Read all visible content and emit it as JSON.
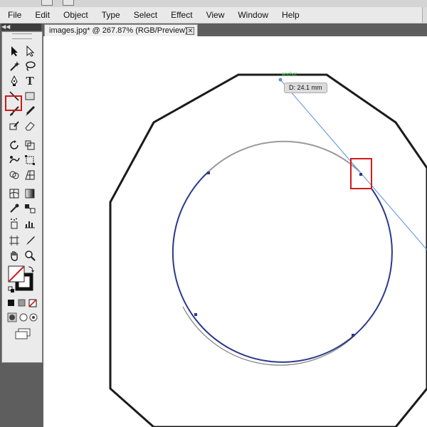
{
  "menu": {
    "items": [
      "File",
      "Edit",
      "Object",
      "Type",
      "Select",
      "Effect",
      "View",
      "Window",
      "Help"
    ]
  },
  "document": {
    "tab_title": "images.jpg* @ 267.87% (RGB/Preview)",
    "close_glyph": "✕"
  },
  "canvas": {
    "measure_tooltip": "D: 24.1 mm",
    "anchor_label": "anchor"
  },
  "colors": {
    "outer_polygon_stroke": "#1b1b1b",
    "path_stroke": "#2b3a8c",
    "guide_line": "#5a8fd8",
    "highlight": "#d01a1a",
    "point_label": "#3fd54a"
  },
  "tools": {
    "icons": [
      "selection-icon",
      "direct-selection-icon",
      "magic-wand-icon",
      "lasso-icon",
      "pen-icon",
      "type-icon",
      "line-segment-icon",
      "rectangle-icon",
      "paintbrush-icon",
      "pencil-icon",
      "blob-brush-icon",
      "eraser-icon",
      "rotate-icon",
      "scale-icon",
      "warp-icon",
      "free-transform-icon",
      "shape-builder-icon",
      "perspective-grid-icon",
      "mesh-icon",
      "gradient-icon",
      "eyedropper-icon",
      "blend-icon",
      "symbol-sprayer-icon",
      "column-graph-icon",
      "artboard-icon",
      "slice-icon",
      "hand-icon",
      "zoom-icon"
    ],
    "selected": "pen-icon"
  }
}
